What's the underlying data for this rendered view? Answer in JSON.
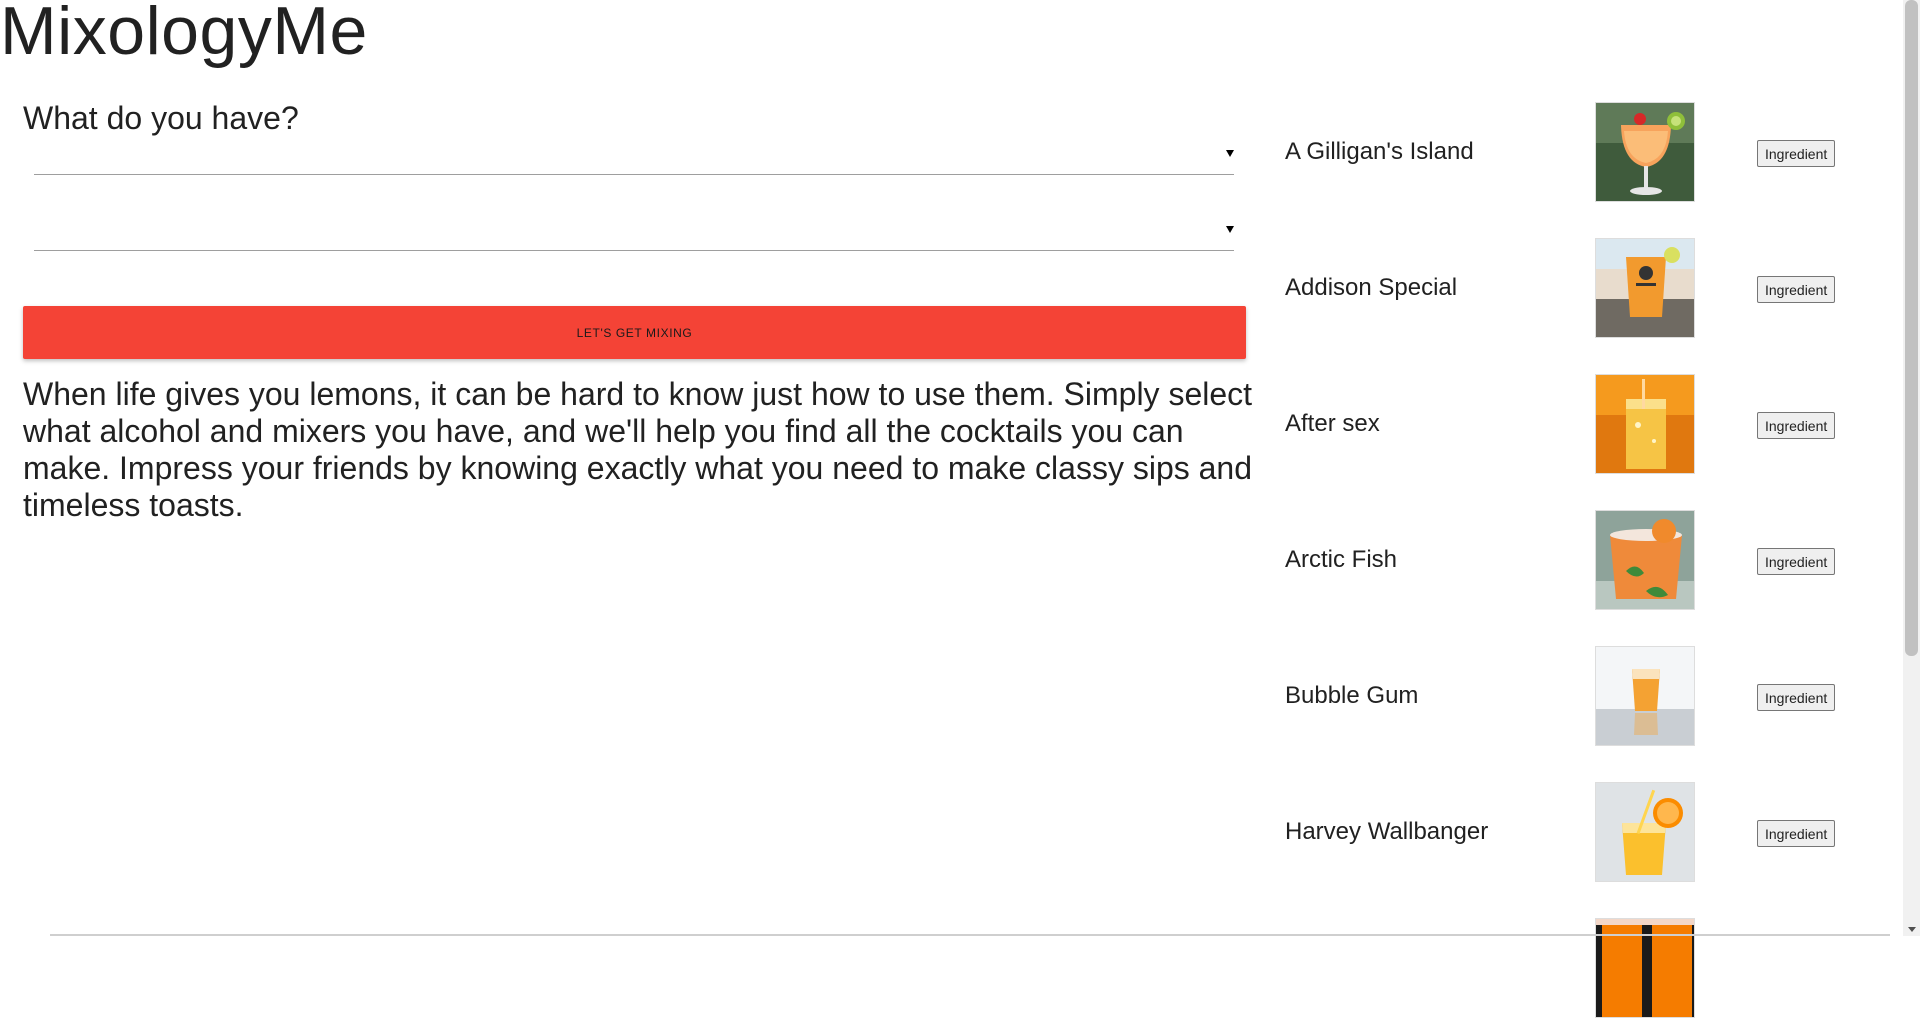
{
  "app": {
    "title": "MixologyMe"
  },
  "form": {
    "heading": "What do you have?",
    "alcohol_select_value": "",
    "mixer_select_value": "",
    "submit_label": "LET'S GET MIXING"
  },
  "intro": {
    "text": "When life gives you lemons, it can be hard to know just how to use them. Simply select what alcohol and mixers you have, and we'll help you find all the cocktails you can make. Impress your friends by knowing exactly what you need to make classy sips and timeless toasts."
  },
  "cocktails": [
    {
      "name": "A Gilligan's Island",
      "button_label": "Ingredient",
      "image": "orange-tropical-drink-photo"
    },
    {
      "name": "Addison Special",
      "button_label": "Ingredient",
      "image": "beach-cup-drink-photo"
    },
    {
      "name": "After sex",
      "button_label": "Ingredient",
      "image": "highball-orange-drink-photo"
    },
    {
      "name": "Arctic Fish",
      "button_label": "Ingredient",
      "image": "citrus-mint-drink-photo"
    },
    {
      "name": "Bubble Gum",
      "button_label": "Ingredient",
      "image": "shot-glass-photo"
    },
    {
      "name": "Harvey Wallbanger",
      "button_label": "Ingredient",
      "image": "orange-juice-glass-photo"
    },
    {
      "name": "",
      "button_label": "",
      "image": "partial-drink-photo"
    }
  ],
  "colors": {
    "accent": "#f44336",
    "text": "#212121"
  }
}
